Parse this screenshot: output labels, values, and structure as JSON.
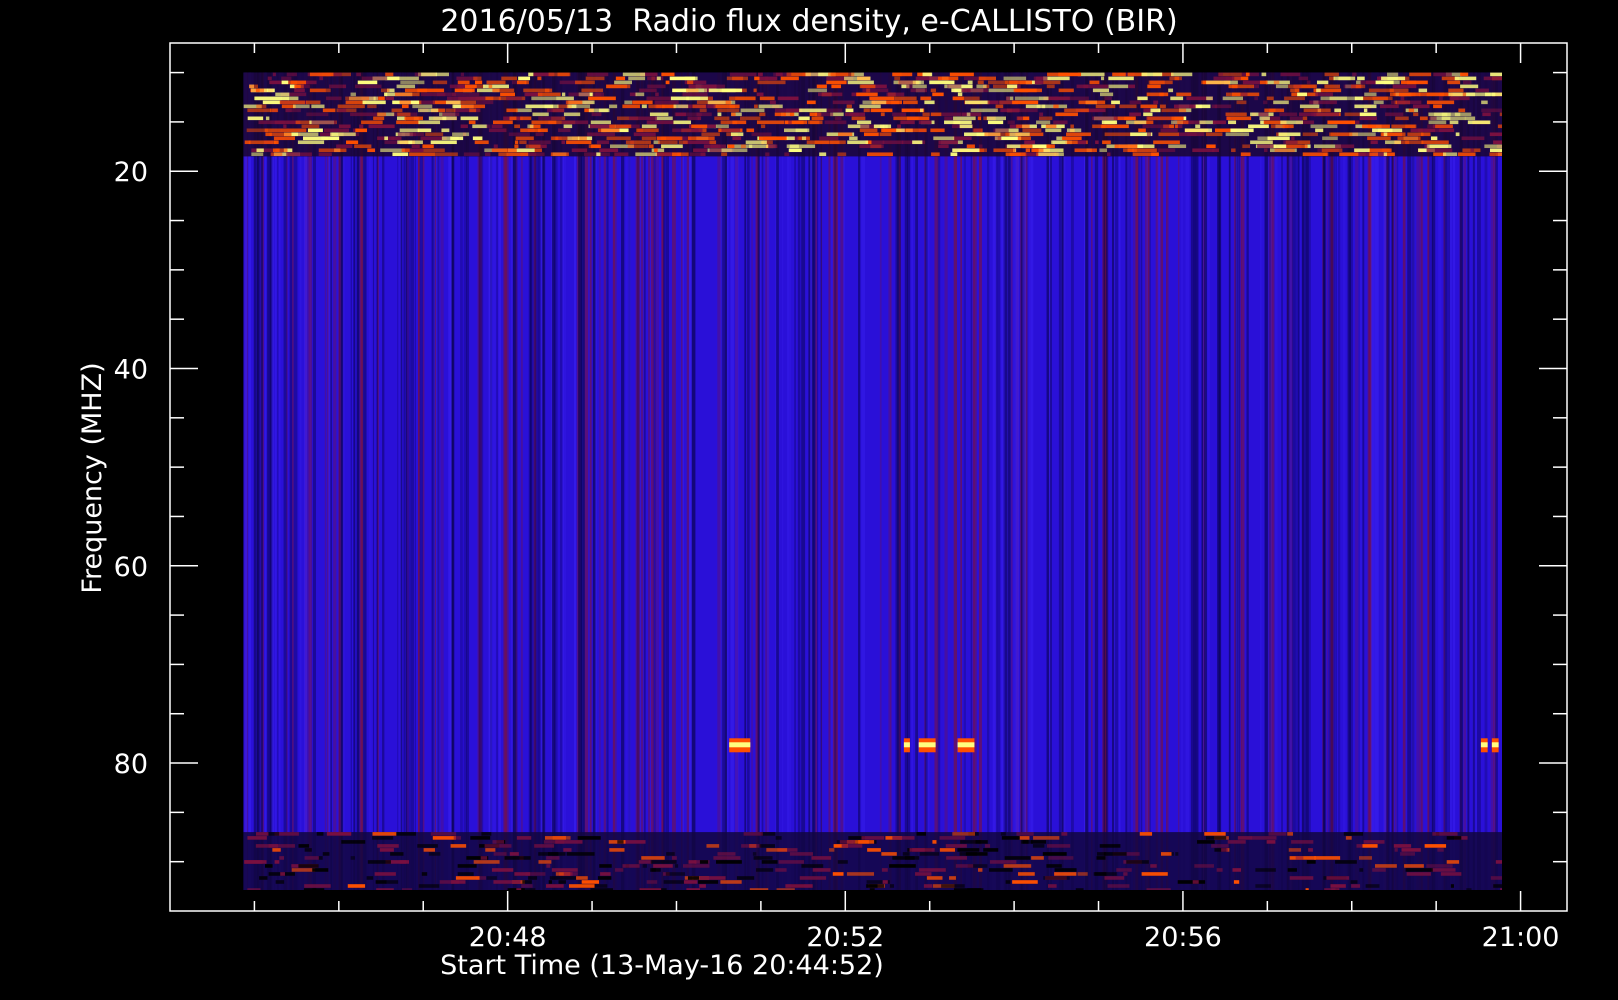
{
  "chart_data": {
    "type": "heatmap",
    "title": "2016/05/13  Radio flux density, e-CALLISTO (BIR)",
    "xlabel": "Start Time (13-May-16 20:44:52)",
    "ylabel": "Frequency (MHZ)",
    "x_unit": "minutes after 20:44",
    "xlim": [
      0.0,
      16.55
    ],
    "ylim": [
      95,
      7
    ],
    "data_extent": {
      "x": [
        0.87,
        16.2
      ],
      "y": [
        93.5,
        10
      ]
    },
    "x_ticks": [
      {
        "value": 4,
        "label": "20:48"
      },
      {
        "value": 8,
        "label": "20:52"
      },
      {
        "value": 12,
        "label": "20:56"
      },
      {
        "value": 16,
        "label": "21:00"
      }
    ],
    "y_ticks": [
      {
        "value": 20,
        "label": "20"
      },
      {
        "value": 40,
        "label": "40"
      },
      {
        "value": 60,
        "label": "60"
      },
      {
        "value": 80,
        "label": "80"
      }
    ],
    "colors": {
      "background": "#000000",
      "baseline": "#2a10d8",
      "low": "#0a0350",
      "mid": "#7a1040",
      "high": "#ff5000",
      "peak": "#ffff80"
    },
    "interference_bands": [
      {
        "f0": 10,
        "f1": 18.5,
        "level": "high"
      },
      {
        "f0": 87,
        "f1": 93.5,
        "level": "low"
      }
    ],
    "hotspots": [
      {
        "t": 6.75,
        "f": 78.2,
        "w": 0.25
      },
      {
        "t": 8.73,
        "f": 78.2,
        "w": 0.07
      },
      {
        "t": 8.97,
        "f": 78.2,
        "w": 0.2
      },
      {
        "t": 9.43,
        "f": 78.2,
        "w": 0.2
      },
      {
        "t": 15.57,
        "f": 78.2,
        "w": 0.08
      },
      {
        "t": 15.7,
        "f": 78.2,
        "w": 0.08
      }
    ]
  }
}
